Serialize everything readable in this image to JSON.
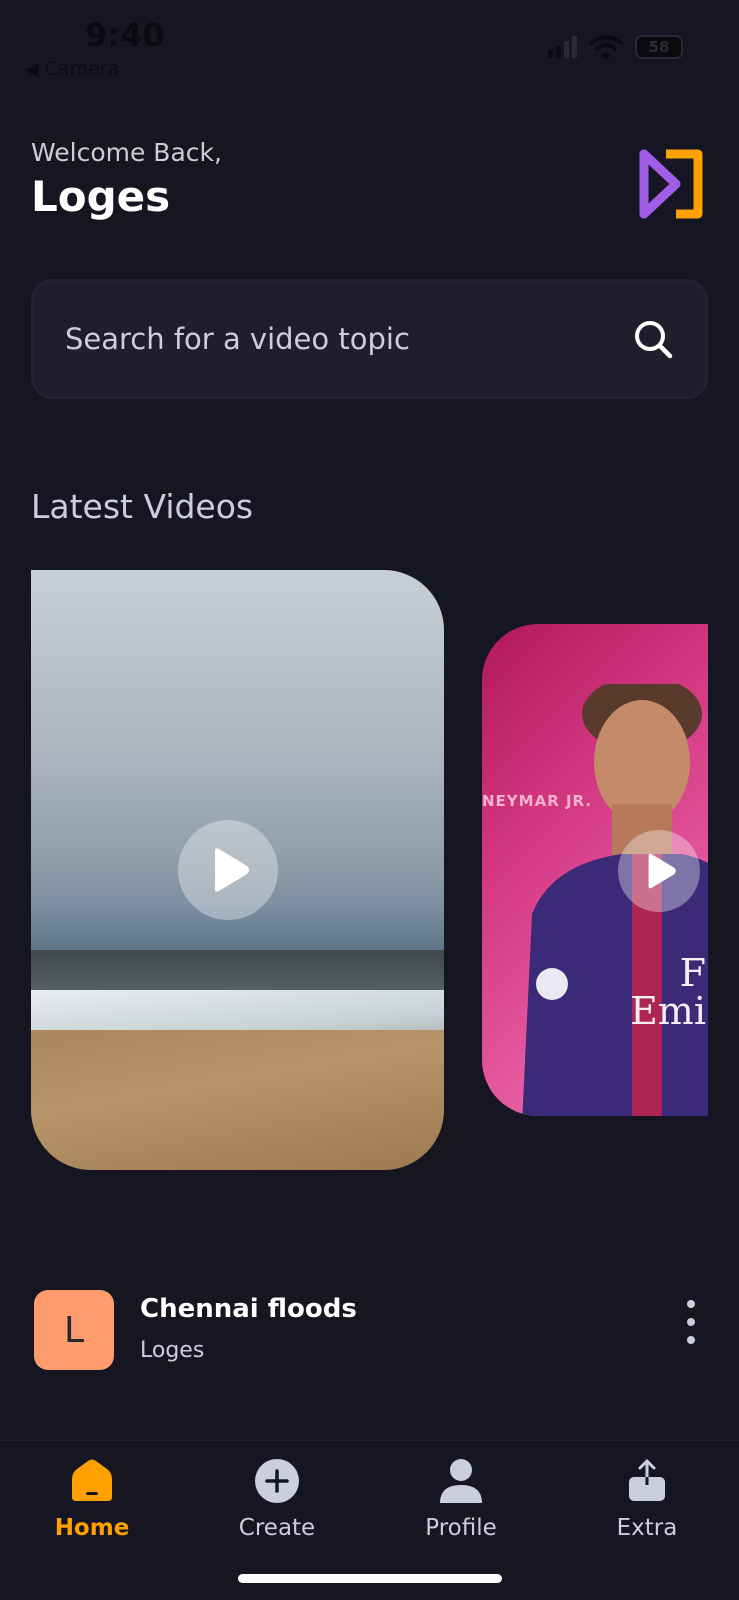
{
  "status_bar": {
    "time": "9:40",
    "back_label": "◀ Camera",
    "battery": "58"
  },
  "header": {
    "welcome": "Welcome Back,",
    "username": "Loges"
  },
  "search": {
    "placeholder": "Search for a video topic"
  },
  "latest": {
    "title": "Latest Videos",
    "cards": [
      {
        "id": "beach"
      },
      {
        "id": "neymar",
        "brand": "NEYMAR JR.",
        "shirt_text": "F\nEmi"
      }
    ]
  },
  "video_item": {
    "avatar_initial": "L",
    "title": "Chennai floods",
    "author": "Loges"
  },
  "tabs": [
    {
      "label": "Home",
      "icon": "home-icon",
      "active": true
    },
    {
      "label": "Create",
      "icon": "plus-icon",
      "active": false
    },
    {
      "label": "Profile",
      "icon": "profile-icon",
      "active": false
    },
    {
      "label": "Extra",
      "icon": "upload-icon",
      "active": false
    }
  ],
  "colors": {
    "background": "#161622",
    "accent": "#FFA001",
    "surface": "#1E1E2D",
    "avatar": "#FF9C6E"
  }
}
